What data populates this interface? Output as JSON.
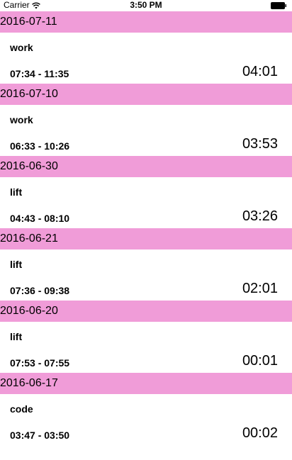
{
  "status_bar": {
    "carrier": "Carrier",
    "time": "3:50 PM"
  },
  "entries": [
    {
      "date": "2016-07-11",
      "activity": "work",
      "range": "07:34 - 11:35",
      "duration": "04:01"
    },
    {
      "date": "2016-07-10",
      "activity": "work",
      "range": "06:33 - 10:26",
      "duration": "03:53"
    },
    {
      "date": "2016-06-30",
      "activity": "lift",
      "range": "04:43 - 08:10",
      "duration": "03:26"
    },
    {
      "date": "2016-06-21",
      "activity": "lift",
      "range": "07:36 - 09:38",
      "duration": "02:01"
    },
    {
      "date": "2016-06-20",
      "activity": "lift",
      "range": "07:53 - 07:55",
      "duration": "00:01"
    },
    {
      "date": "2016-06-17",
      "activity": "code",
      "range": "03:47 - 03:50",
      "duration": "00:02"
    }
  ],
  "colors": {
    "header_bg": "#f09cd8"
  }
}
